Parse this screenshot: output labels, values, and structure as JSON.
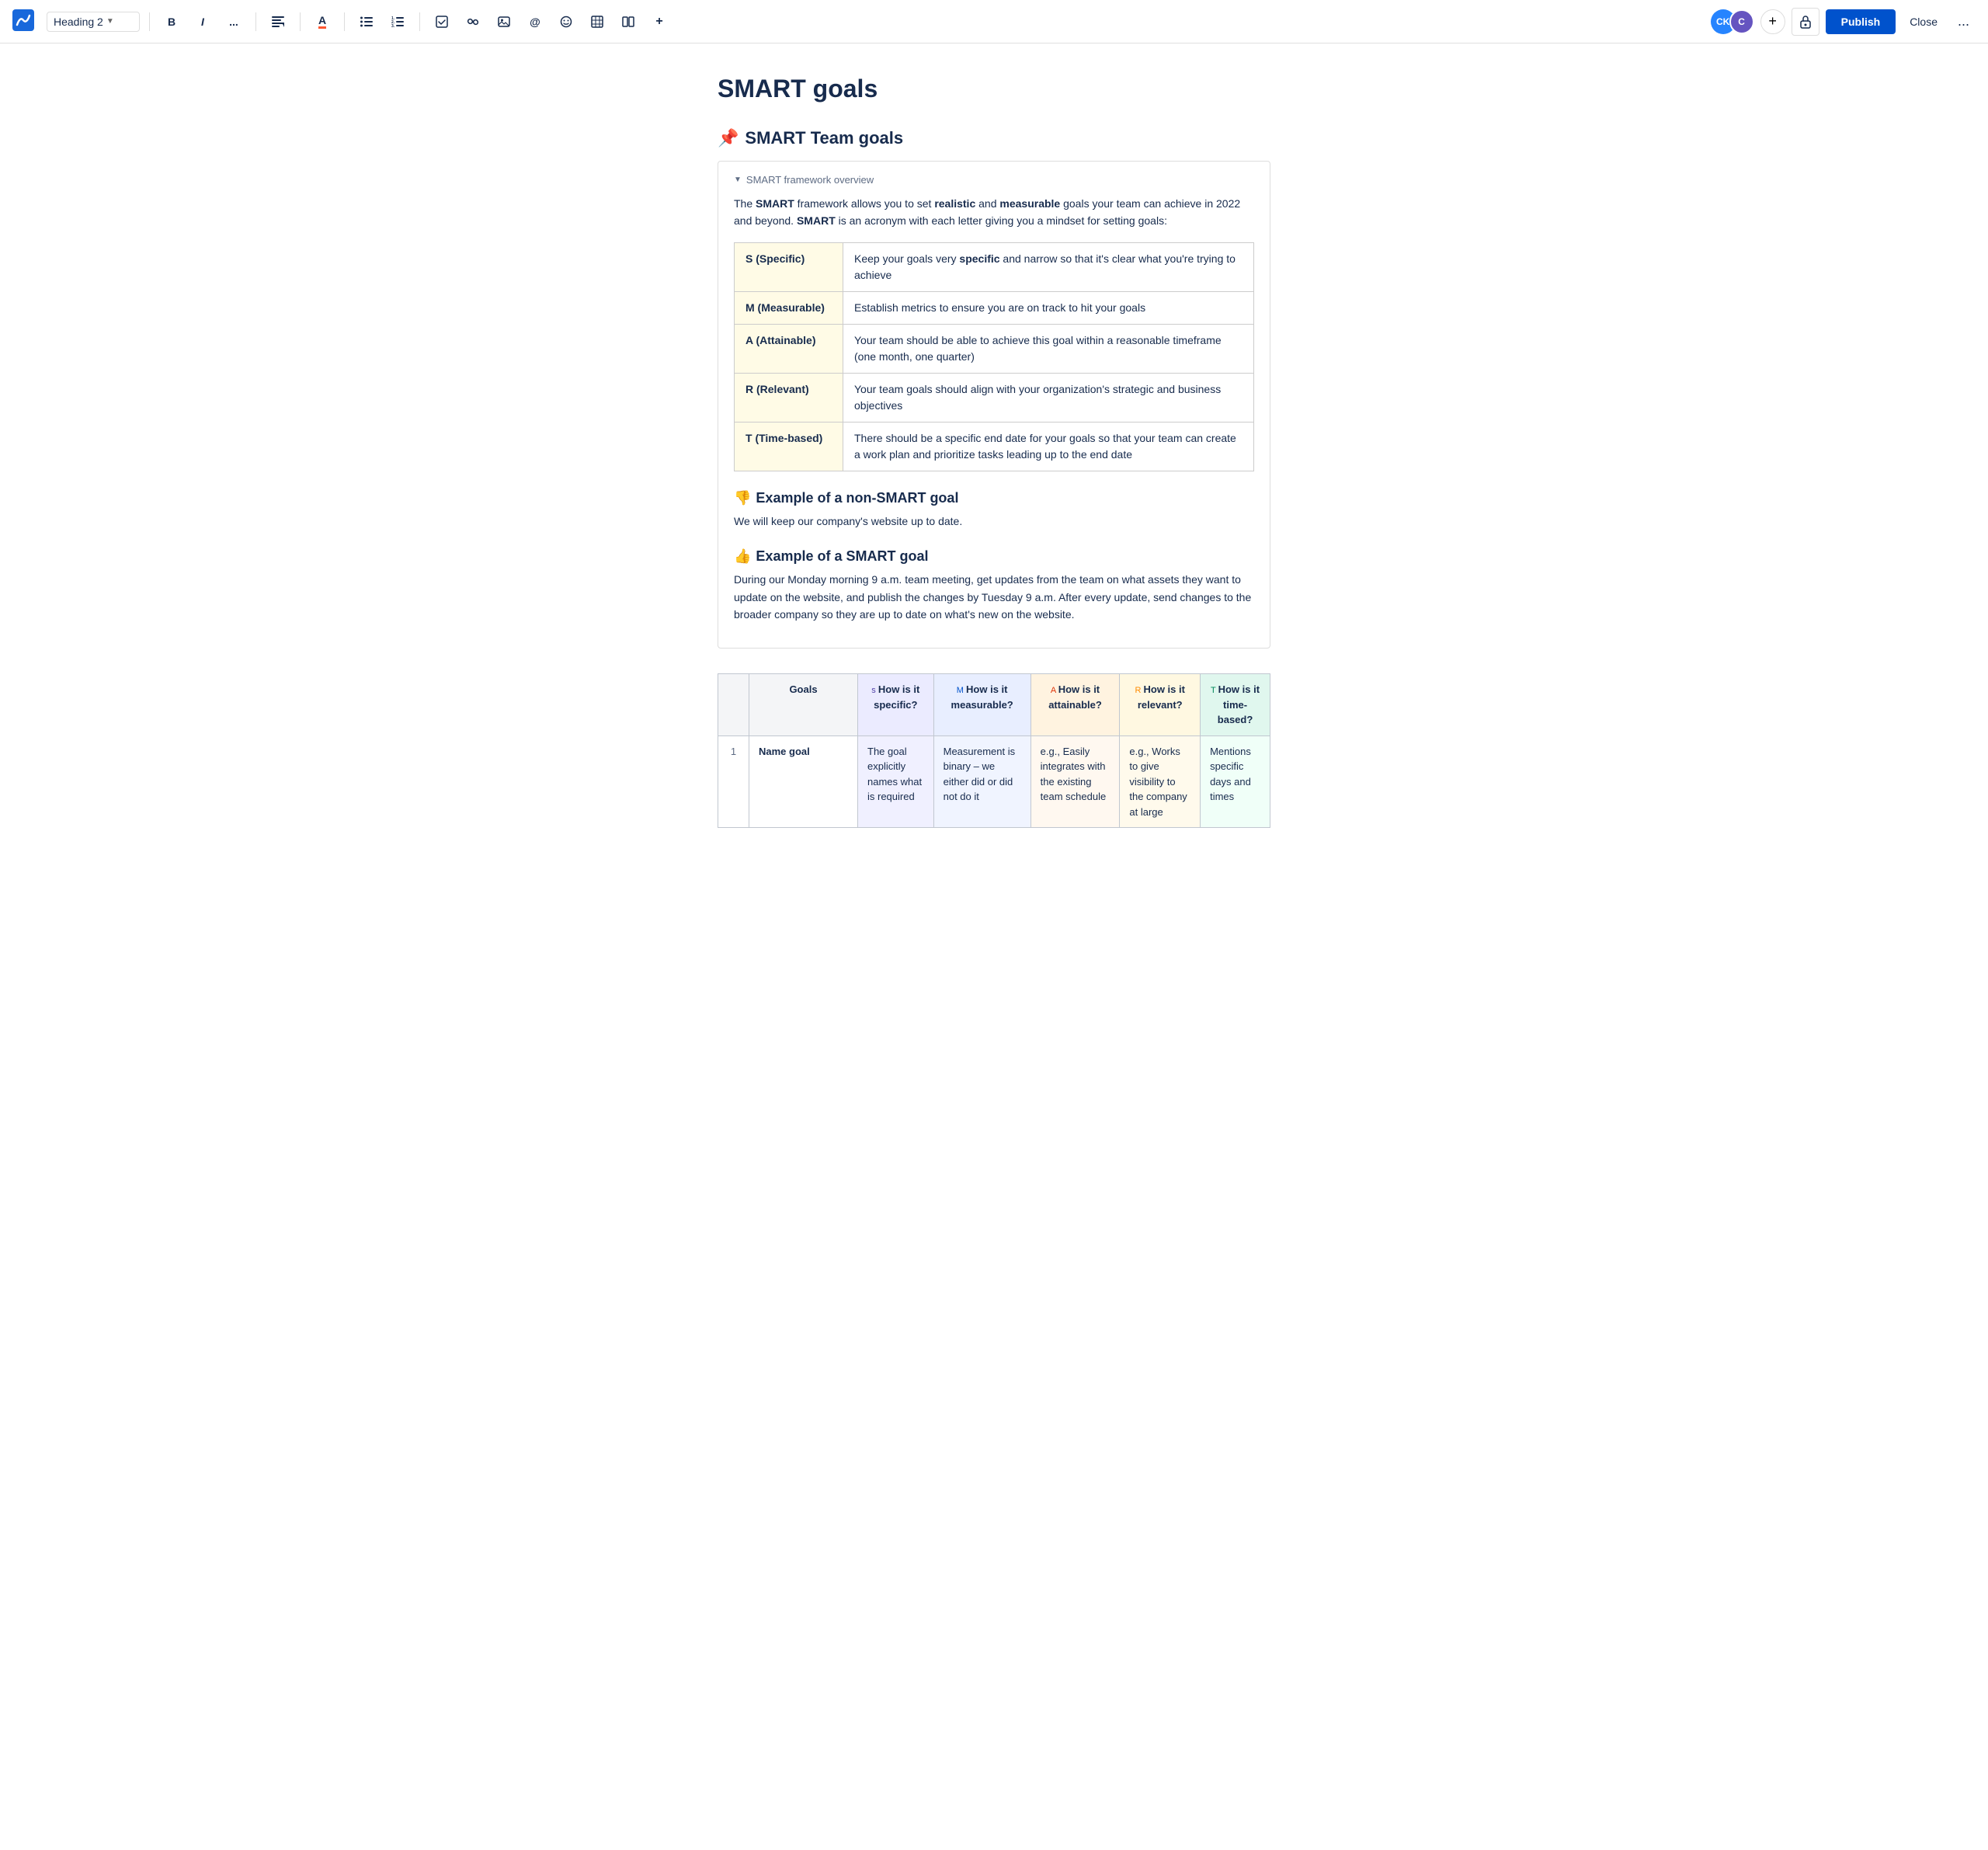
{
  "toolbar": {
    "logo_alt": "Confluence logo",
    "heading_select": "Heading 2",
    "bold_label": "B",
    "italic_label": "I",
    "more_format_label": "...",
    "align_label": "≡",
    "color_label": "A",
    "bullet_list_label": "≡",
    "ordered_list_label": "≡",
    "task_label": "☑",
    "link_label": "🔗",
    "image_label": "🖼",
    "mention_label": "@",
    "emoji_label": "☺",
    "table_label": "⊞",
    "layout_label": "⊟",
    "more_insert_label": "+",
    "avatar_ck_initials": "CK",
    "avatar_c_initials": "C",
    "add_collaborator_label": "+",
    "publish_label": "Publish",
    "close_label": "Close",
    "more_options_label": "..."
  },
  "page": {
    "title": "SMART goals",
    "section1": {
      "heading": "SMART Team goals",
      "heading_icon": "📌",
      "expand": {
        "title": "SMART framework overview",
        "intro": "The SMART framework allows you to set realistic and measurable goals your team can achieve in 2022 and beyond. SMART is an acronym with each letter giving you a mindset for setting goals:",
        "table_rows": [
          {
            "letter": "S (Specific)",
            "description": "Keep your goals very specific and narrow so that it's clear what you're trying to achieve"
          },
          {
            "letter": "M (Measurable)",
            "description": "Establish metrics to ensure you are on track to hit your goals"
          },
          {
            "letter": "A (Attainable)",
            "description": "Your team should be able to achieve this goal within a reasonable timeframe (one month, one quarter)"
          },
          {
            "letter": "R (Relevant)",
            "description": "Your team goals should align with your organization's strategic and business objectives"
          },
          {
            "letter": "T (Time-based)",
            "description": "There should be a specific end date for your goals so that your team can create a work plan and prioritize tasks leading up to the end date"
          }
        ]
      },
      "non_smart": {
        "heading": "Example of a non-SMART goal",
        "icon": "👎",
        "text": "We will keep our company's website up to date."
      },
      "smart": {
        "heading": "Example of a SMART goal",
        "icon": "👍",
        "text": "During our Monday morning 9 a.m. team meeting, get updates from the team on what assets they want to update on the website, and publish the changes by Tuesday 9 a.m. After every update, send changes to the broader company so they are up to date on what's new on the website."
      }
    },
    "goals_table": {
      "columns": [
        {
          "id": "num",
          "label": ""
        },
        {
          "id": "goals",
          "label": "Goals"
        },
        {
          "id": "specific",
          "label": "How is it specific?",
          "prefix": "s",
          "header_class": "header-specific",
          "label_class": "col-label-s"
        },
        {
          "id": "measurable",
          "label": "How is it measurable?",
          "prefix": "M",
          "header_class": "header-measurable",
          "label_class": "col-label-m"
        },
        {
          "id": "attainable",
          "label": "How is it attainable?",
          "prefix": "A",
          "header_class": "header-attainable",
          "label_class": "col-label-a"
        },
        {
          "id": "relevant",
          "label": "How is it relevant?",
          "prefix": "R",
          "header_class": "header-relevant",
          "label_class": "col-label-r"
        },
        {
          "id": "timebased",
          "label": "How is it time-based?",
          "prefix": "T",
          "header_class": "header-timebased",
          "label_class": "col-label-t"
        }
      ],
      "rows": [
        {
          "num": "1",
          "goals": "Name goal",
          "specific": "The goal explicitly names what is required",
          "measurable": "Measurement is binary – we either did or did not do it",
          "attainable": "e.g., Easily integrates with the existing team schedule",
          "relevant": "e.g., Works to give visibility to the company at large",
          "timebased": "Mentions specific days and times"
        }
      ]
    }
  }
}
